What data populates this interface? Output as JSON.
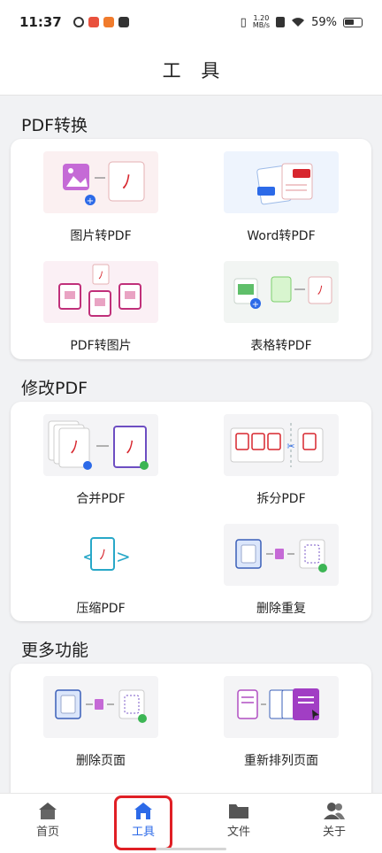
{
  "status_bar": {
    "time": "11:37",
    "net_speed_value": "1.20",
    "net_speed_unit": "MB/s",
    "battery": "59%"
  },
  "header": {
    "title": "工 具"
  },
  "sections": [
    {
      "title": "PDF转换",
      "tools": [
        {
          "label": "图片转PDF",
          "icon": "image-to-pdf-icon"
        },
        {
          "label": "Word转PDF",
          "icon": "word-to-pdf-icon"
        },
        {
          "label": "PDF转图片",
          "icon": "pdf-to-image-icon"
        },
        {
          "label": "表格转PDF",
          "icon": "sheet-to-pdf-icon"
        }
      ]
    },
    {
      "title": "修改PDF",
      "tools": [
        {
          "label": "合并PDF",
          "icon": "merge-pdf-icon"
        },
        {
          "label": "拆分PDF",
          "icon": "split-pdf-icon"
        },
        {
          "label": "压缩PDF",
          "icon": "compress-pdf-icon"
        },
        {
          "label": "删除重复",
          "icon": "remove-duplicate-icon"
        }
      ]
    },
    {
      "title": "更多功能",
      "tools": [
        {
          "label": "删除页面",
          "icon": "delete-page-icon"
        },
        {
          "label": "重新排列页面",
          "icon": "reorder-pages-icon"
        }
      ]
    }
  ],
  "tabs": [
    {
      "label": "首页",
      "icon": "home-icon"
    },
    {
      "label": "工具",
      "icon": "tools-icon",
      "active": true
    },
    {
      "label": "文件",
      "icon": "folder-icon"
    },
    {
      "label": "关于",
      "icon": "people-icon"
    }
  ],
  "colors": {
    "accent": "#2c6ae8",
    "pdf_red": "#d7262e",
    "highlight": "#e01f25"
  }
}
